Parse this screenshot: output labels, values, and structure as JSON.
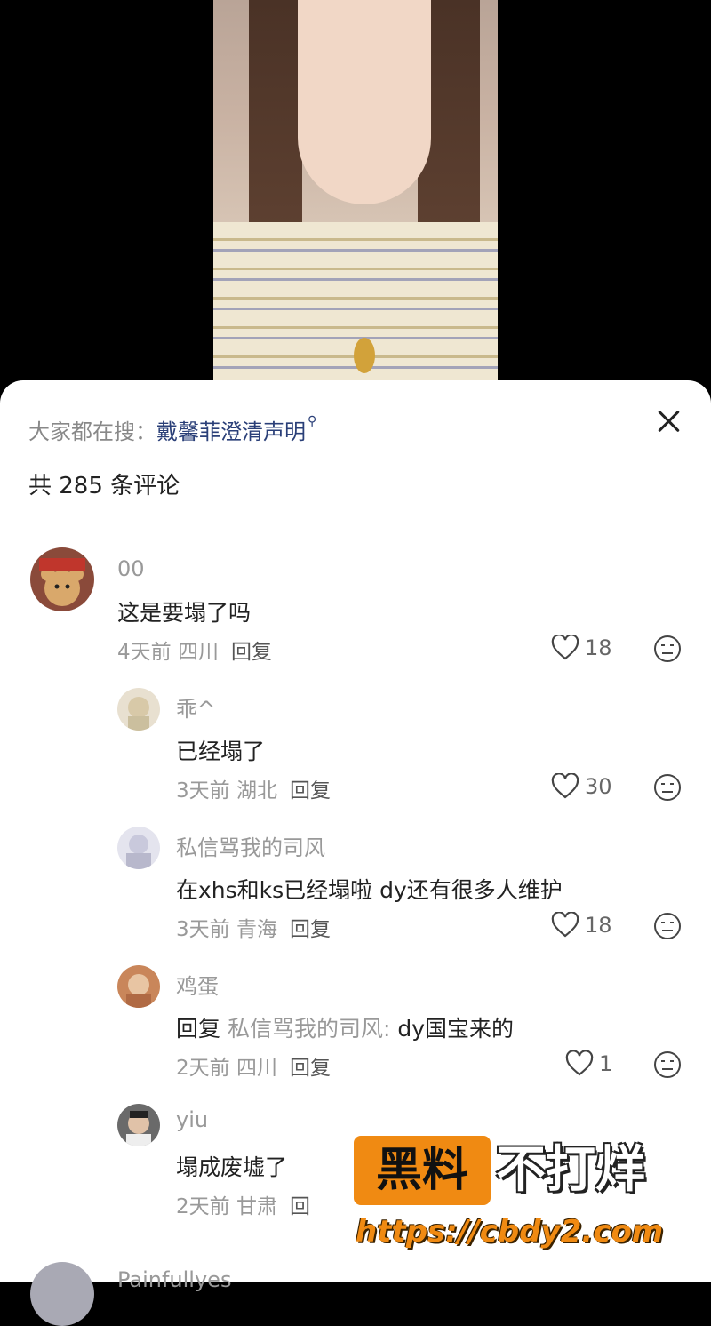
{
  "search": {
    "prefix": "大家都在搜：",
    "term": "戴馨菲澄清声明",
    "icon": "search-icon"
  },
  "comment_count": "共 285 条评论",
  "comments": [
    {
      "name": "00",
      "text": "这是要塌了吗",
      "time": "4天前",
      "location": "四川",
      "reply": "回复",
      "likes": "18"
    },
    {
      "name": "乖^",
      "text": "已经塌了",
      "time": "3天前",
      "location": "湖北",
      "reply": "回复",
      "likes": "30"
    },
    {
      "name": "私信骂我的司风",
      "text": "在xhs和ks已经塌啦 dy还有很多人维护",
      "time": "3天前",
      "location": "青海",
      "reply": "回复",
      "likes": "18"
    },
    {
      "name": "鸡蛋",
      "reply_prefix": "回复",
      "reply_to": "私信骂我的司风:",
      "text": " dy国宝来的",
      "time": "2天前",
      "location": "四川",
      "reply": "回复",
      "likes": "1"
    },
    {
      "name": "yiu",
      "text": "塌成废墟了",
      "time": "2天前",
      "location": "甘肃",
      "reply": "回"
    },
    {
      "name": "Painfullyes"
    }
  ],
  "watermark": {
    "box_text": "黑料",
    "side_text": "不打烊",
    "url": "https://cbdy2.com"
  },
  "colors": {
    "link": "#2a3f78",
    "watermark_orange": "#f08a12"
  }
}
